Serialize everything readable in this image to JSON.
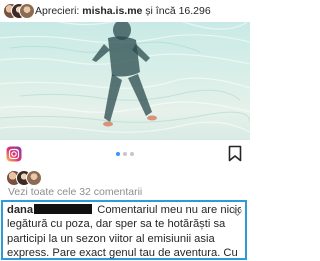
{
  "post": {
    "likes_strip": {
      "prefix": "Aprecieri: ",
      "user": "misha.is.me",
      "suffix": " și încă 16.296"
    },
    "view_comments": "Vezi toate cele 32 comentarii"
  },
  "comment": {
    "username": "dana",
    "lines": [
      "Comentariul meu nu are nicio",
      "legătură cu poza, dar sper sa te hotărăști sa",
      "participi la un sezon viitor al emisiunii asia",
      "express. Pare exact genul tau de aventura. Cu"
    ]
  },
  "colors": {
    "highlight_border": "#2f9bd6",
    "carousel_active": "#3897f0",
    "muted_text": "#8e8e8e"
  },
  "icons": [
    "instagram-logo-icon",
    "bookmark-icon",
    "heart-icon",
    "carousel-dots"
  ]
}
